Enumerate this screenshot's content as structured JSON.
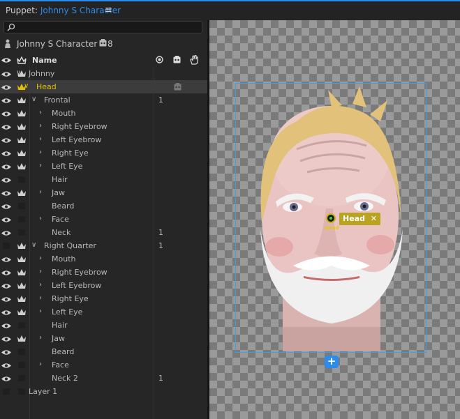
{
  "window": {
    "prefix": "Puppet:",
    "name": "Johnny S Character",
    "menu_glyph": "≡"
  },
  "search": {
    "placeholder": ""
  },
  "character": {
    "name": "Johnny S Character",
    "badge_count": "8"
  },
  "columns": {
    "name": "Name"
  },
  "rows": [
    {
      "label": "Johnny",
      "chevron": "∨",
      "crown": true,
      "num": ""
    },
    {
      "label": "Head",
      "chevron": "∨",
      "crown": true,
      "num": "",
      "selected": true
    },
    {
      "label": "Frontal",
      "chevron": "∨",
      "crown": true,
      "num": "1"
    },
    {
      "label": "Mouth",
      "chevron": "›",
      "crown": true,
      "num": ""
    },
    {
      "label": "Right Eyebrow",
      "chevron": "›",
      "crown": true,
      "num": ""
    },
    {
      "label": "Left Eyebrow",
      "chevron": "›",
      "crown": true,
      "num": ""
    },
    {
      "label": "Right Eye",
      "chevron": "›",
      "crown": true,
      "num": ""
    },
    {
      "label": "Left Eye",
      "chevron": "›",
      "crown": true,
      "num": ""
    },
    {
      "label": "Hair",
      "chevron": "",
      "crown": false,
      "num": ""
    },
    {
      "label": "Jaw",
      "chevron": "›",
      "crown": true,
      "num": ""
    },
    {
      "label": "Beard",
      "chevron": "",
      "crown": false,
      "num": ""
    },
    {
      "label": "Face",
      "chevron": "›",
      "crown": false,
      "num": ""
    },
    {
      "label": "Neck",
      "chevron": "",
      "crown": false,
      "num": "1"
    },
    {
      "label": "Right Quarter",
      "chevron": "∨",
      "crown": true,
      "num": "1",
      "eye_hidden": true
    },
    {
      "label": "Mouth",
      "chevron": "›",
      "crown": true,
      "num": ""
    },
    {
      "label": "Right Eyebrow",
      "chevron": "›",
      "crown": true,
      "num": ""
    },
    {
      "label": "Left Eyebrow",
      "chevron": "›",
      "crown": true,
      "num": ""
    },
    {
      "label": "Right Eye",
      "chevron": "›",
      "crown": true,
      "num": ""
    },
    {
      "label": "Left Eye",
      "chevron": "›",
      "crown": true,
      "num": ""
    },
    {
      "label": "Hair",
      "chevron": "",
      "crown": false,
      "num": ""
    },
    {
      "label": "Jaw",
      "chevron": "›",
      "crown": true,
      "num": ""
    },
    {
      "label": "Beard",
      "chevron": "",
      "crown": false,
      "num": ""
    },
    {
      "label": "Face",
      "chevron": "›",
      "crown": false,
      "num": ""
    },
    {
      "label": "Neck 2",
      "chevron": "",
      "crown": false,
      "num": "1"
    },
    {
      "label": "Layer 1",
      "chevron": "",
      "crown": false,
      "num": "",
      "eye_hidden": true
    }
  ],
  "canvas": {
    "tag_label": "Head",
    "tag_close": "✕",
    "handle_label": "Head",
    "add_button": "+"
  },
  "colors": {
    "accent": "#2d8ceb",
    "selected_text": "#e0c000",
    "tag_bg": "#b9a320"
  },
  "icons": [
    "search-icon",
    "puppet-icon",
    "behavior-icon",
    "eye-icon",
    "crown-icon",
    "origin-icon",
    "handle-tool-icon",
    "close-icon",
    "add-icon"
  ]
}
